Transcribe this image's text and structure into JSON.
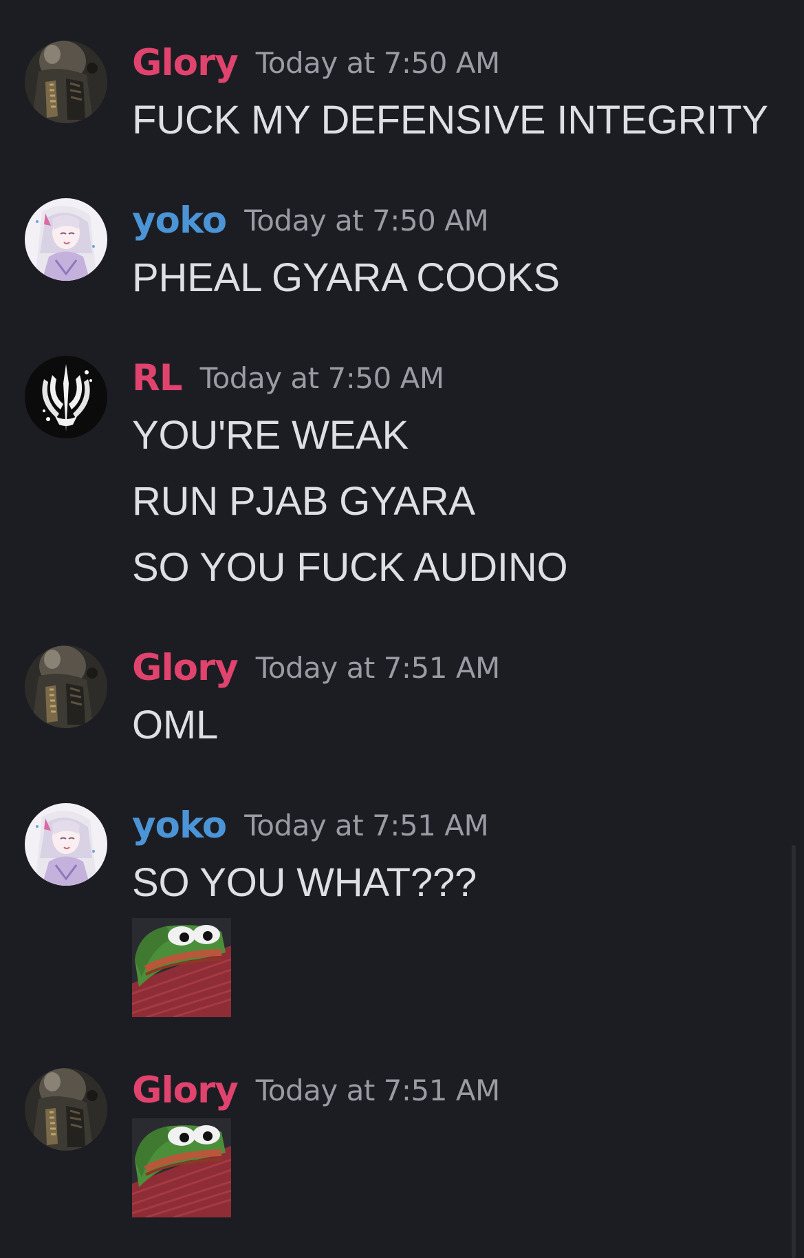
{
  "colors": {
    "background": "#1c1d22",
    "glory": "#e0436d",
    "yoko": "#4b94d6",
    "rl": "#e0436d",
    "timestamp": "#9a9ba4",
    "text": "#dedfe4"
  },
  "messages": [
    {
      "username": "Glory",
      "timestamp": "Today at 7:50 AM",
      "lines": [
        "FUCK MY DEFENSIVE INTEGRITY"
      ],
      "avatar": "armored-knight-avatar"
    },
    {
      "username": "yoko",
      "timestamp": "Today at 7:50 AM",
      "lines": [
        "PHEAL GYARA COOKS"
      ],
      "avatar": "anime-girl-avatar"
    },
    {
      "username": "RL",
      "timestamp": "Today at 7:50 AM",
      "lines": [
        "YOU'RE WEAK",
        "RUN PJAB GYARA",
        "SO YOU FUCK AUDINO"
      ],
      "avatar": "trident-emblem-avatar"
    },
    {
      "username": "Glory",
      "timestamp": "Today at 7:51 AM",
      "lines": [
        "OML"
      ],
      "avatar": "armored-knight-avatar"
    },
    {
      "username": "yoko",
      "timestamp": "Today at 7:51 AM",
      "lines": [
        "SO YOU WHAT???"
      ],
      "sticker": "peeking-pepe-sticker",
      "avatar": "anime-girl-avatar"
    },
    {
      "username": "Glory",
      "timestamp": "Today at 7:51 AM",
      "lines": [],
      "sticker": "peeking-pepe-sticker",
      "avatar": "armored-knight-avatar"
    }
  ]
}
